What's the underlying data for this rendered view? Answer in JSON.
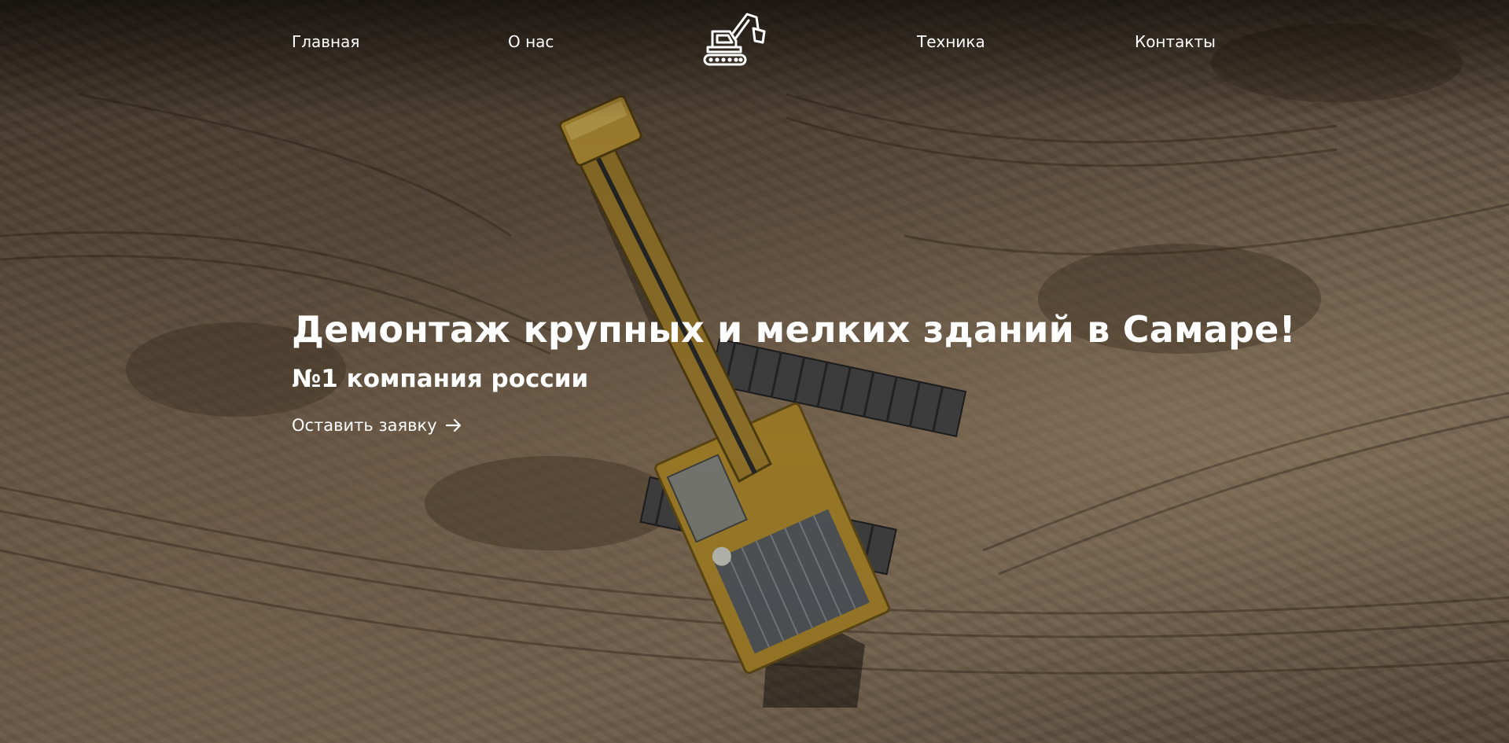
{
  "nav": {
    "items": [
      {
        "label": "Главная"
      },
      {
        "label": "О нас"
      },
      {
        "label": "Техника"
      },
      {
        "label": "Контакты"
      }
    ],
    "logo_icon": "excavator-icon"
  },
  "hero": {
    "headline": "Демонтаж крупных и мелких зданий в Самаре!",
    "subheadline": "№1 компания россии",
    "cta_label": "Оставить заявку",
    "cta_icon": "arrow-right-icon",
    "background": "aerial-excavator-photo"
  },
  "colors": {
    "text": "#ffffff",
    "excavator": "#c9a13b",
    "ground": "#7a6650"
  }
}
